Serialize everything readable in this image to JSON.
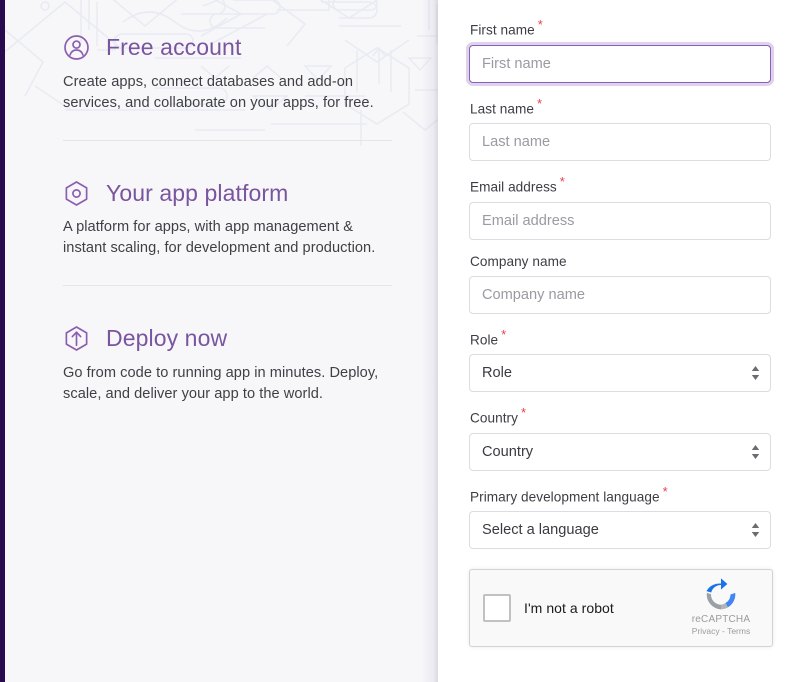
{
  "left_panel": {
    "features": [
      {
        "icon": "user-circle-icon",
        "title": "Free account",
        "description": "Create apps, connect databases and add-on services, and collaborate on your apps, for free."
      },
      {
        "icon": "hexagon-dot-icon",
        "title": "Your app platform",
        "description": "A platform for apps, with app management & instant scaling, for development and production."
      },
      {
        "icon": "hexagon-arrow-up-icon",
        "title": "Deploy now",
        "description": "Go from code to running app in minutes. Deploy, scale, and deliver your app to the world."
      }
    ]
  },
  "form": {
    "required_marker": "*",
    "fields": [
      {
        "name": "first-name",
        "label": "First name",
        "placeholder": "First name",
        "value": "",
        "required": true,
        "type": "text",
        "focused": true
      },
      {
        "name": "last-name",
        "label": "Last name",
        "placeholder": "Last name",
        "value": "",
        "required": true,
        "type": "text",
        "focused": false
      },
      {
        "name": "email",
        "label": "Email address",
        "placeholder": "Email address",
        "value": "",
        "required": true,
        "type": "text",
        "focused": false
      },
      {
        "name": "company",
        "label": "Company name",
        "placeholder": "Company name",
        "value": "",
        "required": false,
        "type": "text",
        "focused": false
      },
      {
        "name": "role",
        "label": "Role",
        "placeholder": "Role",
        "value": "Role",
        "required": true,
        "type": "select",
        "focused": false
      },
      {
        "name": "country",
        "label": "Country",
        "placeholder": "Country",
        "value": "Country",
        "required": true,
        "type": "select",
        "focused": false
      },
      {
        "name": "language",
        "label": "Primary development language",
        "placeholder": "Select a language",
        "value": "Select a language",
        "required": true,
        "type": "select",
        "focused": false
      }
    ]
  },
  "recaptcha": {
    "checkbox_label": "I'm not a robot",
    "brand_name": "reCAPTCHA",
    "links": "Privacy - Terms",
    "logo_icon": "recaptcha-logo-icon"
  },
  "colors": {
    "accent_purple": "#7a559f",
    "icon_purple": "#8a5fb0",
    "edge_stripe": "#2a0a4f",
    "required_red": "#e8404a",
    "focus_border": "#8b5fb5",
    "panel_bg": "#f7f7fa"
  }
}
